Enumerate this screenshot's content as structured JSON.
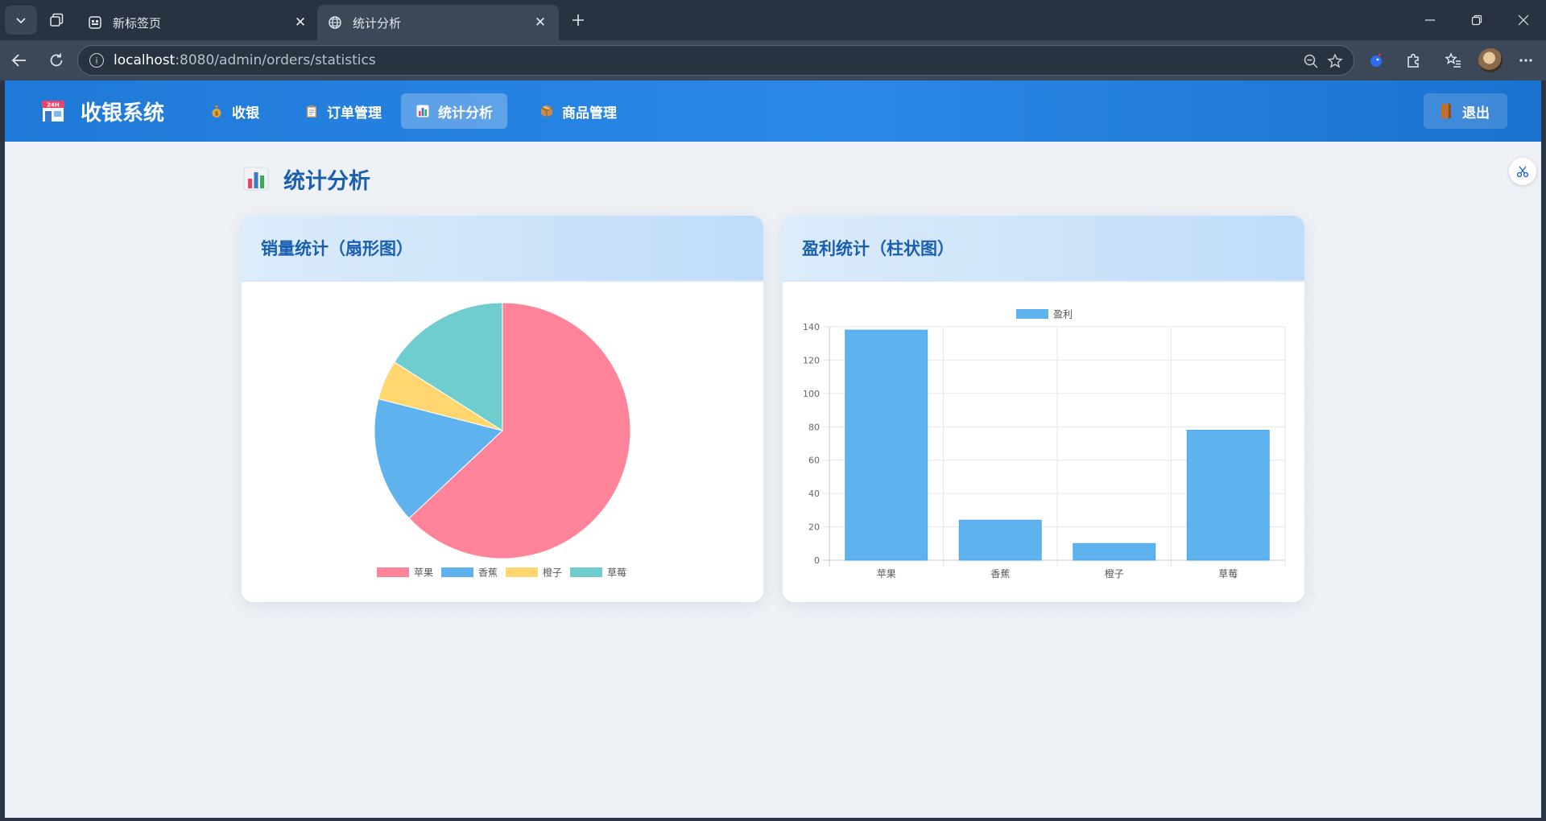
{
  "browser": {
    "tabs": [
      {
        "label": "新标签页",
        "active": false
      },
      {
        "label": "统计分析",
        "active": true
      }
    ],
    "url_host": "localhost",
    "url_rest": ":8080/admin/orders/statistics"
  },
  "app": {
    "brand": "收银系统",
    "menu": [
      {
        "label": "收银",
        "icon": "money-bag-icon"
      },
      {
        "label": "订单管理",
        "icon": "clipboard-icon"
      },
      {
        "label": "统计分析",
        "icon": "bar-chart-icon",
        "active": true
      },
      {
        "label": "商品管理",
        "icon": "package-icon"
      }
    ],
    "logout": "退出"
  },
  "page": {
    "title": "统计分析"
  },
  "cards": {
    "sales_title": "销量统计（扇形图）",
    "profit_title": "盈利统计（柱状图）"
  },
  "colors": {
    "apple": "#ff8499",
    "banana": "#5eb3ef",
    "orange": "#ffd670",
    "strawberry": "#70cdcd",
    "bar": "#5eb3ef"
  },
  "chart_data": [
    {
      "type": "pie",
      "title": "销量统计（扇形图）",
      "categories": [
        "苹果",
        "香蕉",
        "橙子",
        "草莓"
      ],
      "values": [
        63,
        16,
        5,
        16
      ],
      "legend": "bottom"
    },
    {
      "type": "bar",
      "title": "盈利统计（柱状图）",
      "categories": [
        "苹果",
        "香蕉",
        "橙子",
        "草莓"
      ],
      "series": [
        {
          "name": "盈利",
          "values": [
            138,
            24,
            10,
            78
          ]
        }
      ],
      "ylim": [
        0,
        140
      ],
      "yticks": [
        0,
        20,
        40,
        60,
        80,
        100,
        120,
        140
      ],
      "grid": true,
      "legend": "top"
    }
  ]
}
